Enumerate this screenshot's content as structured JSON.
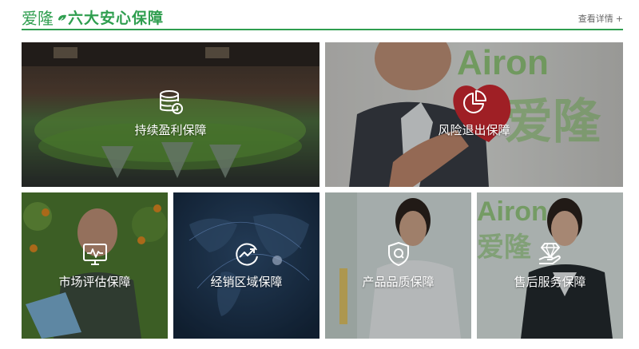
{
  "header": {
    "brand": "爱隆",
    "title": "六大安心保障",
    "more_link": "查看详情",
    "more_plus": "+"
  },
  "colors": {
    "accent": "#2f9e4f",
    "card_label": "#ffffff"
  },
  "cards": [
    {
      "label": "持续盈利保障",
      "icon": "database-coin-icon"
    },
    {
      "label": "风险退出保障",
      "icon": "pie-chart-icon"
    },
    {
      "label": "市场评估保障",
      "icon": "monitor-pulse-icon"
    },
    {
      "label": "经销区域保障",
      "icon": "circle-trend-arrow-icon"
    },
    {
      "label": "产品品质保障",
      "icon": "shield-q-icon"
    },
    {
      "label": "售后服务保障",
      "icon": "hand-diamond-icon"
    }
  ]
}
